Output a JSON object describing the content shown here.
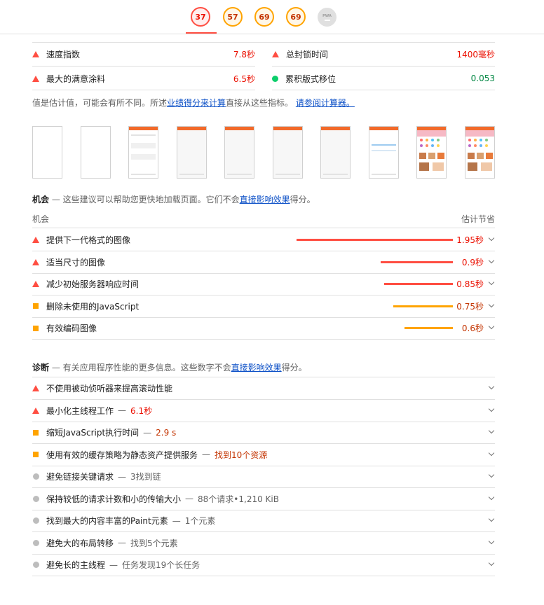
{
  "gauges": [
    {
      "value": "37",
      "status": "fail"
    },
    {
      "value": "57",
      "status": "average"
    },
    {
      "value": "69",
      "status": "average"
    },
    {
      "value": "69",
      "status": "average"
    },
    {
      "value": "—",
      "label": "PWA",
      "status": "na"
    }
  ],
  "metrics": [
    {
      "label": "速度指数",
      "value": "7.8秒",
      "status": "fail"
    },
    {
      "label": "总封锁时间",
      "value": "1400毫秒",
      "status": "fail"
    },
    {
      "label": "最大的满意涂料",
      "value": "6.5秒",
      "status": "fail"
    },
    {
      "label": "累积版式移位",
      "value": "0.053",
      "status": "pass"
    }
  ],
  "note": {
    "prefix": "值是估计值，可能会有所不同。所述",
    "link1": "业绩得分来计算",
    "middle": "直接从这些指标。",
    "link2": "请参阅计算器。"
  },
  "opportunities": {
    "heading": "机会",
    "description_prefix": " — 这些建议可以帮助您更快地加载页面。它们不会",
    "description_link": "直接影响效果",
    "description_suffix": "得分。",
    "col_left": "机会",
    "col_right": "估计节省",
    "items": [
      {
        "title": "提供下一代格式的图像",
        "saving": "1.95秒",
        "fraction": 1.0,
        "status": "fail"
      },
      {
        "title": "适当尺寸的图像",
        "saving": "0.9秒",
        "fraction": 0.46,
        "status": "fail"
      },
      {
        "title": "减少初始服务器响应时间",
        "saving": "0.85秒",
        "fraction": 0.44,
        "status": "fail"
      },
      {
        "title": "删除未使用的JavaScript",
        "saving": "0.75秒",
        "fraction": 0.38,
        "status": "average"
      },
      {
        "title": "有效编码图像",
        "saving": "0.6秒",
        "fraction": 0.31,
        "status": "average"
      }
    ]
  },
  "diagnostics": {
    "heading": "诊断",
    "description_prefix": " — 有关应用程序性能的更多信息。这些数字不会",
    "description_link": "直接影响效果",
    "description_suffix": "得分。",
    "items": [
      {
        "title": "不使用被动侦听器来提高滚动性能",
        "display": "",
        "status": "fail"
      },
      {
        "title": "最小化主线程工作",
        "display": "6.1秒",
        "status": "fail"
      },
      {
        "title": "缩短JavaScript执行时间",
        "display": "2.9 s",
        "status": "average"
      },
      {
        "title": "使用有效的缓存策略为静态资产提供服务",
        "display": "找到10个资源",
        "status": "average"
      },
      {
        "title": "避免链接关键请求",
        "display": "3找到链",
        "status": "info"
      },
      {
        "title": "保持较低的请求计数和小的传输大小",
        "display": "88个请求•1,210 KiB",
        "status": "info"
      },
      {
        "title": "找到最大的内容丰富的Paint元素",
        "display": "1个元素",
        "status": "info"
      },
      {
        "title": "避免大的布局转移",
        "display": "找到5个元素",
        "status": "info"
      },
      {
        "title": "避免长的主线程",
        "display": "任务发现19个长任务",
        "status": "info"
      }
    ]
  },
  "colors": {
    "fail": "#ff4e42",
    "average": "#ffa400",
    "pass": "#0cce6b",
    "info": "#bdbdbd"
  }
}
